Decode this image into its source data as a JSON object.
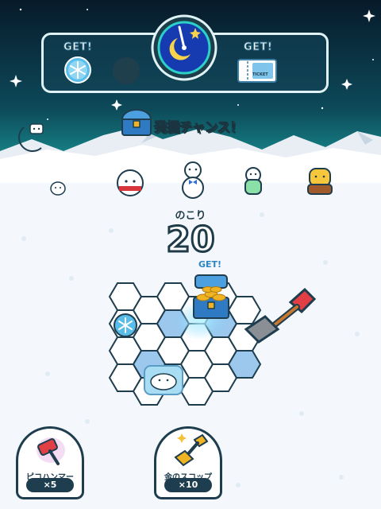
{
  "top_panel": {
    "left_get_label": "GET!",
    "right_get_label": "GET!",
    "ticket_label": "TICKET"
  },
  "banner": {
    "text": "発掘チャンス！"
  },
  "counter": {
    "label": "のこり",
    "value": "20"
  },
  "board": {
    "reward_label": "GET!"
  },
  "items": [
    {
      "name": "ピコハンマー",
      "count": "×5"
    },
    {
      "name": "金のスコップ",
      "count": "×10"
    }
  ],
  "colors": {
    "sky_top": "#071a2a",
    "sky_mid": "#0e5566",
    "sky_glow": "#1fb7b0",
    "outline": "#1e3d4e",
    "highlight_hex": "#7fb6e8",
    "gold": "#f0b323"
  }
}
